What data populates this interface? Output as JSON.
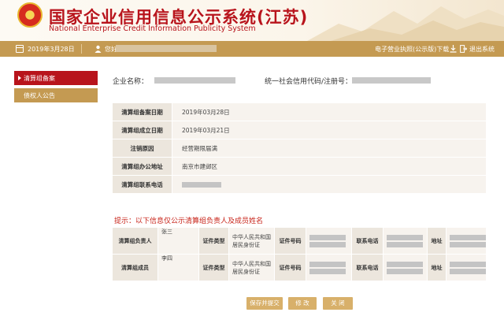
{
  "header": {
    "title": "国家企业信用信息公示系统(江苏)",
    "subtitle": "National Enterprise Credit Information Publicity System"
  },
  "topbar": {
    "date": "2019年3月28日",
    "welcome": "您好",
    "download": "电子营业执照(公示版)下载",
    "logout": "退出系统"
  },
  "sidebar": {
    "items": [
      {
        "label": "清算组备案",
        "active": true
      },
      {
        "label": "债权人公告",
        "active": false
      }
    ]
  },
  "company": {
    "name_label": "企业名称：",
    "code_label": "统一社会信用代码/注册号："
  },
  "details": {
    "rows": [
      {
        "label": "清算组备案日期",
        "value": "2019年03月28日"
      },
      {
        "label": "清算组成立日期",
        "value": "2019年03月21日"
      },
      {
        "label": "注销原因",
        "value": "经营期限届满"
      },
      {
        "label": "清算组办公地址",
        "value": "南京市建邺区"
      },
      {
        "label": "清算组联系电话",
        "value": ""
      }
    ]
  },
  "tip": "提示：以下信息仅公示清算组负责人及成员姓名",
  "members": {
    "cert_type_label": "证件类型",
    "cert_no_label": "证件号码",
    "phone_label": "联系电话",
    "address_label": "地址",
    "rows": [
      {
        "role": "清算组负责人",
        "name": "张三",
        "cert_type": "中华人民共和国居民身份证"
      },
      {
        "role": "清算组成员",
        "name": "李四",
        "cert_type": "中华人民共和国居民身份证"
      }
    ]
  },
  "buttons": {
    "save": "保存并提交",
    "edit": "修 改",
    "close": "关 闭"
  },
  "colors": {
    "brand_red": "#b8141c",
    "gold": "#c49a52",
    "button": "#d8b06a",
    "tip_red": "#c8241a"
  }
}
